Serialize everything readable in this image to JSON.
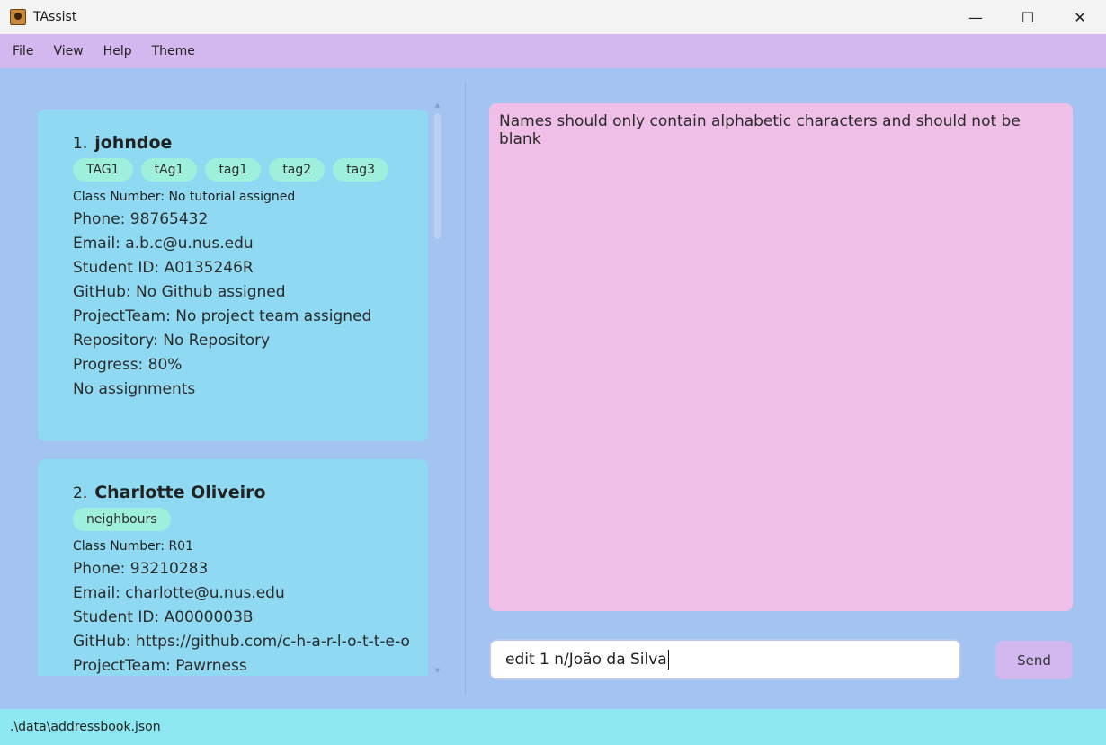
{
  "window": {
    "title": "TAssist",
    "controls": [
      "—",
      "☐",
      "✕"
    ]
  },
  "menu": [
    "File",
    "View",
    "Help",
    "Theme"
  ],
  "people": [
    {
      "index": "1.",
      "name": "johndoe",
      "tags": [
        "TAG1",
        "tAg1",
        "tag1",
        "tag2",
        "tag3"
      ],
      "class_number": "Class Number: No tutorial assigned",
      "phone": "Phone: 98765432",
      "email": "Email: a.b.c@u.nus.edu",
      "student_id": "Student ID: A0135246R",
      "github": "GitHub: No Github assigned",
      "project_team": "ProjectTeam: No project team assigned",
      "repository": "Repository: No Repository",
      "progress": "Progress: 80%",
      "assignments": "No assignments"
    },
    {
      "index": "2.",
      "name": "Charlotte Oliveiro",
      "tags": [
        "neighbours"
      ],
      "class_number": "Class Number: R01",
      "phone": "Phone: 93210283",
      "email": "Email: charlotte@u.nus.edu",
      "student_id": "Student ID: A0000003B",
      "github": "GitHub: https://github.com/c-h-a-r-l-o-t-t-e-o",
      "project_team": "ProjectTeam: Pawrness"
    }
  ],
  "result": {
    "message": "Names should only contain alphabetic characters and should not be blank"
  },
  "command": {
    "value": "edit 1 n/João da Silva",
    "send_label": "Send"
  },
  "status": {
    "path": ".\\data\\addressbook.json"
  }
}
